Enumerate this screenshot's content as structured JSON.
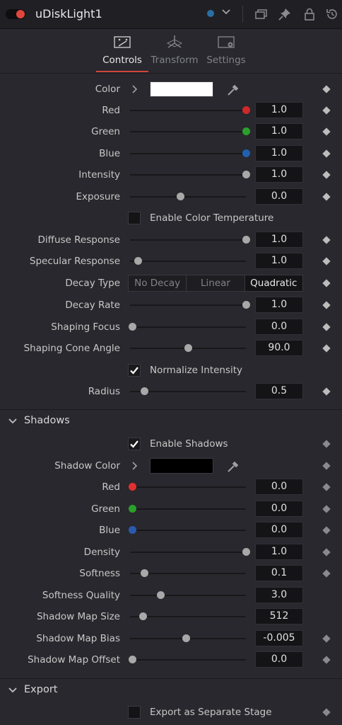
{
  "header": {
    "title": "uDiskLight1"
  },
  "tabs": [
    {
      "label": "Controls",
      "icon": "controls-icon",
      "active": true
    },
    {
      "label": "Transform",
      "icon": "transform-icon",
      "active": false
    },
    {
      "label": "Settings",
      "icon": "settings-icon",
      "active": false
    }
  ],
  "controls": {
    "color": {
      "label": "Color",
      "swatch": "#ffffff"
    },
    "red": {
      "label": "Red",
      "value": "1.0",
      "level": 1.0
    },
    "green": {
      "label": "Green",
      "value": "1.0",
      "level": 1.0
    },
    "blue": {
      "label": "Blue",
      "value": "1.0",
      "level": 1.0
    },
    "intensity": {
      "label": "Intensity",
      "value": "1.0",
      "level": 1.0
    },
    "exposure": {
      "label": "Exposure",
      "value": "0.0",
      "level": 0.43
    },
    "enable_color_temperature": {
      "label": "Enable Color Temperature",
      "checked": false
    },
    "diffuse_response": {
      "label": "Diffuse Response",
      "value": "1.0",
      "level": 1.0
    },
    "specular_response": {
      "label": "Specular Response",
      "value": "1.0",
      "level": 0.07
    },
    "decay_type": {
      "label": "Decay Type",
      "options": [
        "No Decay",
        "Linear",
        "Quadratic"
      ],
      "selected": "Quadratic"
    },
    "decay_rate": {
      "label": "Decay Rate",
      "value": "1.0",
      "level": 1.0
    },
    "shaping_focus": {
      "label": "Shaping Focus",
      "value": "0.0",
      "level": 0.02
    },
    "shaping_cone_angle": {
      "label": "Shaping Cone Angle",
      "value": "90.0",
      "level": 0.5
    },
    "normalize_intensity": {
      "label": "Normalize Intensity",
      "checked": true
    },
    "radius": {
      "label": "Radius",
      "value": "0.5",
      "level": 0.12
    }
  },
  "shadows": {
    "section_label": "Shadows",
    "enable_shadows": {
      "label": "Enable Shadows",
      "checked": true
    },
    "shadow_color": {
      "label": "Shadow Color",
      "swatch": "#000000"
    },
    "red": {
      "label": "Red",
      "value": "0.0",
      "level": 0.02,
      "color": "#e03030"
    },
    "green": {
      "label": "Green",
      "value": "0.0",
      "level": 0.02,
      "color": "#2aa02a"
    },
    "blue": {
      "label": "Blue",
      "value": "0.0",
      "level": 0.02,
      "color": "#2a5aaf"
    },
    "density": {
      "label": "Density",
      "value": "1.0",
      "level": 1.0
    },
    "softness": {
      "label": "Softness",
      "value": "0.1",
      "level": 0.12
    },
    "softness_quality": {
      "label": "Softness Quality",
      "value": "3.0",
      "level": 0.26
    },
    "shadow_map_size": {
      "label": "Shadow Map Size",
      "value": "512",
      "level": 0.11
    },
    "shadow_map_bias": {
      "label": "Shadow Map Bias",
      "value": "-0.005",
      "level": 0.48
    },
    "shadow_map_offset": {
      "label": "Shadow Map Offset",
      "value": "0.0",
      "level": 0.02
    }
  },
  "export": {
    "section_label": "Export",
    "export_separate_stage": {
      "label": "Export as Separate Stage",
      "checked": false
    }
  },
  "colors": {
    "accent": "#d0453c",
    "red_thumb": "#d02828",
    "green_thumb": "#2aa02a",
    "blue_thumb": "#2060b0"
  }
}
